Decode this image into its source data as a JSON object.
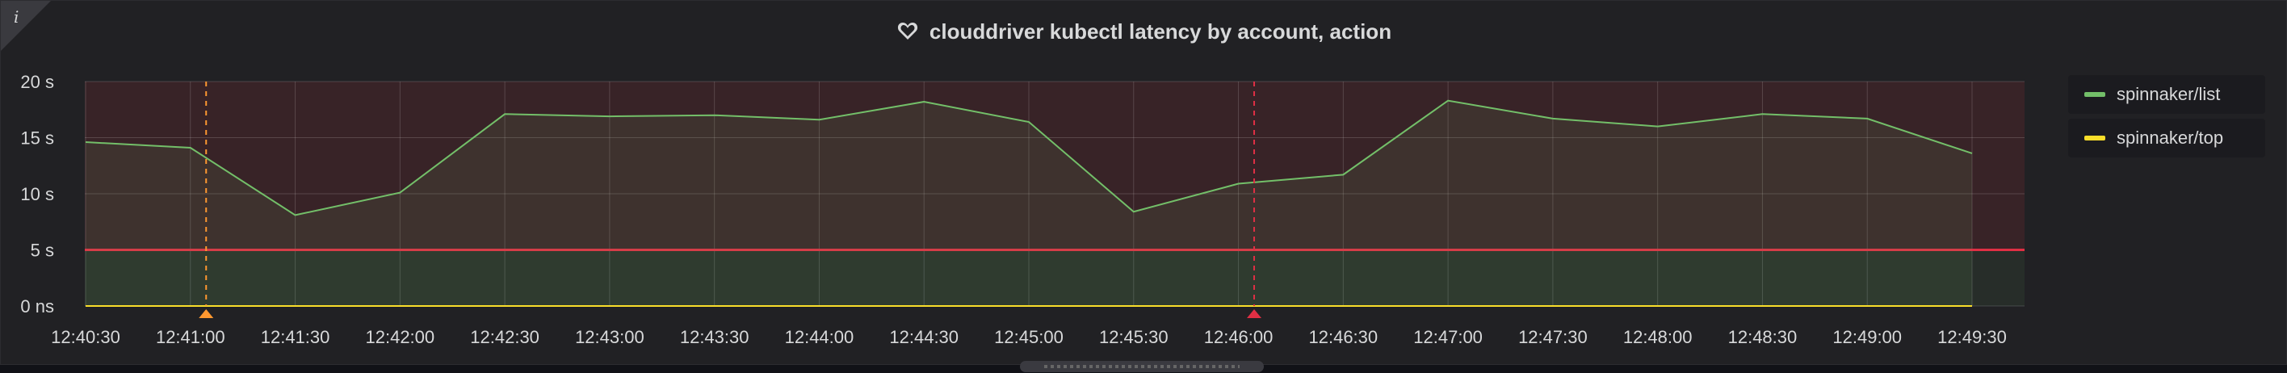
{
  "panel": {
    "title": "clouddriver kubectl latency by account, action",
    "icons": {
      "title": "heart-icon",
      "info": "info-icon"
    },
    "info_glyph": "i"
  },
  "chart_data": {
    "type": "line",
    "title": "clouddriver kubectl latency by account, action",
    "x": [
      "12:40:30",
      "12:41:00",
      "12:41:30",
      "12:42:00",
      "12:42:30",
      "12:43:00",
      "12:43:30",
      "12:44:00",
      "12:44:30",
      "12:45:00",
      "12:45:30",
      "12:46:00",
      "12:46:30",
      "12:47:00",
      "12:47:30",
      "12:48:00",
      "12:48:30",
      "12:49:00",
      "12:49:30"
    ],
    "x_ticks": [
      "12:40:30",
      "12:41:00",
      "12:41:30",
      "12:42:00",
      "12:42:30",
      "12:43:00",
      "12:43:30",
      "12:44:00",
      "12:44:30",
      "12:45:00",
      "12:45:30",
      "12:46:00",
      "12:46:30",
      "12:47:00",
      "12:47:30",
      "12:48:00",
      "12:48:30",
      "12:49:00",
      "12:49:30"
    ],
    "y_ticks": [
      {
        "value": 0,
        "label": "0 ns"
      },
      {
        "value": 5,
        "label": "5 s"
      },
      {
        "value": 10,
        "label": "10 s"
      },
      {
        "value": 15,
        "label": "15 s"
      },
      {
        "value": 20,
        "label": "20 s"
      }
    ],
    "ylim": [
      0,
      20
    ],
    "series": [
      {
        "name": "spinnaker/list",
        "color": "#73bf69",
        "values": [
          14.6,
          14.1,
          8.1,
          10.1,
          17.1,
          16.9,
          17.0,
          16.6,
          18.2,
          16.4,
          8.4,
          10.9,
          11.7,
          18.3,
          16.7,
          16.0,
          17.1,
          16.7,
          13.6
        ]
      },
      {
        "name": "spinnaker/top",
        "color": "#fade2a",
        "values": [
          0,
          0,
          0,
          0,
          0,
          0,
          0,
          0,
          0,
          0,
          0,
          0,
          0,
          0,
          0,
          0,
          0,
          0,
          0
        ]
      }
    ],
    "threshold": {
      "value": 5,
      "color": "#e02f44"
    },
    "annotations": [
      {
        "x_index": 1.15,
        "color": "#ff9830"
      },
      {
        "x_index": 11.15,
        "color": "#e02f44"
      }
    ],
    "grid": true,
    "legend": "right"
  }
}
